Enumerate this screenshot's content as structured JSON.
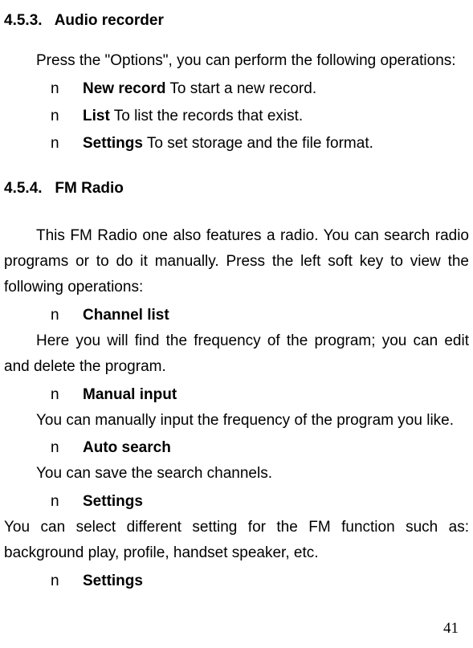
{
  "section1": {
    "number": "4.5.3.",
    "title": "Audio recorder",
    "intro": "Press the \"Options\", you can perform the following operations:",
    "items": [
      {
        "bullet": "n",
        "label": "New record",
        "desc": " To start a new record."
      },
      {
        "bullet": "n",
        "label": "List",
        "desc": "     To list the records that exist."
      },
      {
        "bullet": "n",
        "label": "Settings",
        "desc": " To set storage and the file format."
      }
    ]
  },
  "section2": {
    "number": "4.5.4.",
    "title": "FM Radio",
    "intro": "This FM Radio one also features a radio. You can search radio programs or to do it manually. Press the left soft key to view the following operations:",
    "items": [
      {
        "bullet": "n",
        "label": "Channel list",
        "desc": "Here you will find the frequency of the program; you can edit and delete the program."
      },
      {
        "bullet": "n",
        "label": "Manual input",
        "desc": "You can manually input the frequency of the program you like."
      },
      {
        "bullet": "n",
        "label": "Auto search",
        "desc": "You can save the search channels."
      },
      {
        "bullet": "n",
        "label": "Settings",
        "desc": "You can select different setting for the FM function such as: background play, profile, handset speaker, etc."
      },
      {
        "bullet": "n",
        "label": "Settings",
        "desc": ""
      }
    ]
  },
  "pageNumber": "41"
}
